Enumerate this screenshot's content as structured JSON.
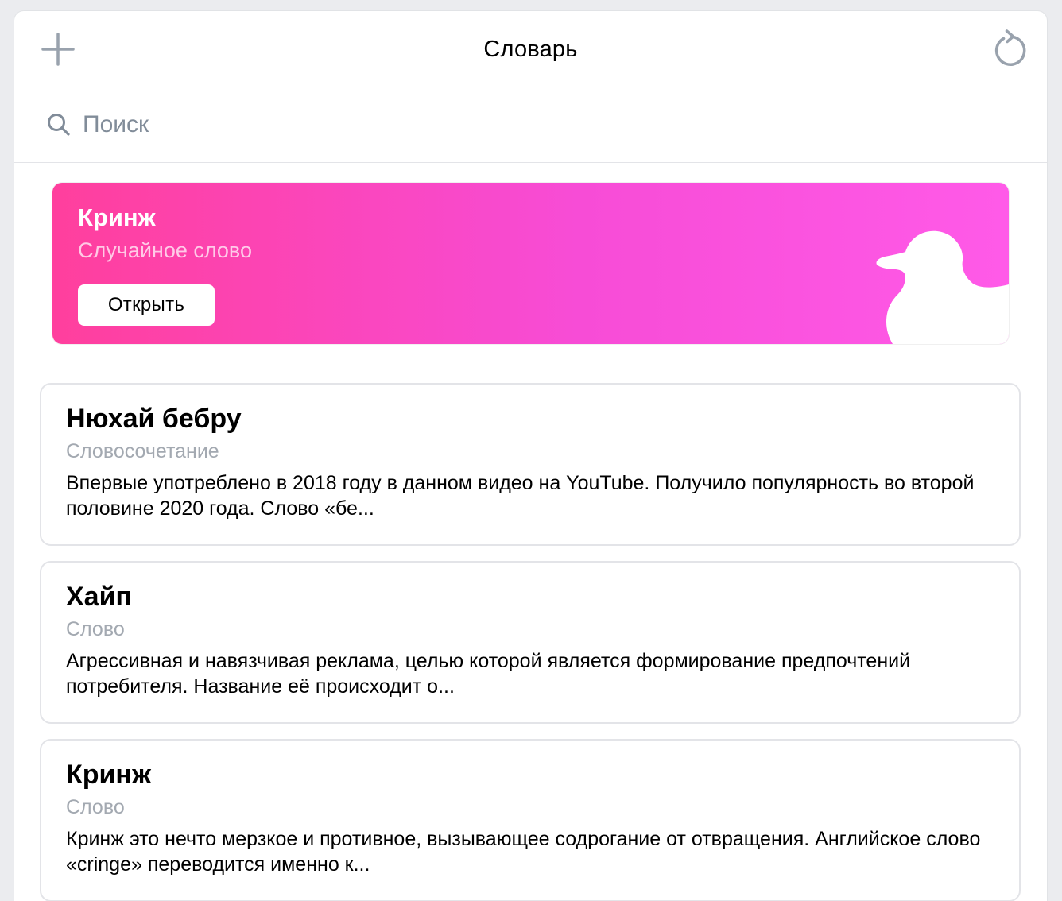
{
  "header": {
    "title": "Словарь",
    "add_icon": "plus-icon",
    "refresh_icon": "refresh-icon"
  },
  "search": {
    "icon": "search-icon",
    "placeholder": "Поиск",
    "value": ""
  },
  "random_word": {
    "title": "Кринж",
    "subtitle": "Случайное слово",
    "button_label": "Открыть",
    "illustration": "duck-icon",
    "gradient_colors": [
      "#ff3f9d",
      "#f74cd6",
      "#ff5ae8"
    ]
  },
  "words": [
    {
      "title": "Нюхай бебру",
      "type": "Словосочетание",
      "description": "Впервые употреблено в 2018 году в данном видео на YouTube. Получило популярность во второй половине 2020 года. Слово «бе..."
    },
    {
      "title": "Хайп",
      "type": "Слово",
      "description": "Агрессивная и навязчивая реклама, целью которой является формирование предпочтений потребителя. Название её происходит о..."
    },
    {
      "title": "Кринж",
      "type": "Слово",
      "description": "Кринж это нечто мерзкое и противное, вызывающее содрогание от отвращения. Английское слово «cringe» переводится именно к..."
    }
  ],
  "colors": {
    "accent": "#99a2ad",
    "secondary_text": "#a3a9b1",
    "placeholder": "#818c99",
    "separator": "#e3e4e8"
  }
}
